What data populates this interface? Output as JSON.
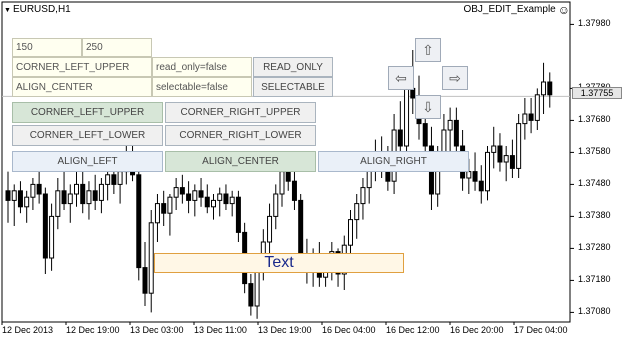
{
  "chart": {
    "symbol": "EURUSD,H1",
    "expert": "OBJ_EDIT_Example",
    "current_price": "1.37755",
    "price_labels": [
      "1.37980",
      "1.37780",
      "1.37680",
      "1.37580",
      "1.37480",
      "1.37380",
      "1.37280",
      "1.37180",
      "1.37080"
    ],
    "time_labels": [
      "12 Dec 2013",
      "12 Dec 19:00",
      "13 Dec 03:00",
      "13 Dec 11:00",
      "13 Dec 19:00",
      "16 Dec 04:00",
      "16 Dec 12:00",
      "16 Dec 20:00",
      "17 Dec 04:00"
    ],
    "colors": {
      "bull": "#ffffff",
      "bear": "#000000",
      "wick": "#000000",
      "grid": "#ffffff",
      "ask_line": "#c0c0c0"
    },
    "candles": [
      [
        1.3746,
        1.3752,
        1.3736,
        1.3743
      ],
      [
        1.3743,
        1.3748,
        1.3735,
        1.3746
      ],
      [
        1.3746,
        1.3749,
        1.3739,
        1.3741
      ],
      [
        1.3741,
        1.3746,
        1.3736,
        1.3744
      ],
      [
        1.3744,
        1.375,
        1.374,
        1.3748
      ],
      [
        1.3748,
        1.3752,
        1.3742,
        1.3745
      ],
      [
        1.3745,
        1.3747,
        1.372,
        1.3725
      ],
      [
        1.3725,
        1.3742,
        1.3721,
        1.3738
      ],
      [
        1.3738,
        1.375,
        1.3734,
        1.3746
      ],
      [
        1.3746,
        1.3752,
        1.374,
        1.3742
      ],
      [
        1.3742,
        1.3748,
        1.3736,
        1.3745
      ],
      [
        1.3745,
        1.3752,
        1.3741,
        1.3748
      ],
      [
        1.3748,
        1.3752,
        1.3739,
        1.3742
      ],
      [
        1.3742,
        1.3749,
        1.3737,
        1.3746
      ],
      [
        1.3746,
        1.3751,
        1.374,
        1.3743
      ],
      [
        1.3743,
        1.375,
        1.3739,
        1.3748
      ],
      [
        1.3748,
        1.3756,
        1.3743,
        1.3751
      ],
      [
        1.3751,
        1.3758,
        1.3745,
        1.3748
      ],
      [
        1.3748,
        1.3755,
        1.3742,
        1.3752
      ],
      [
        1.3752,
        1.376,
        1.3748,
        1.3755
      ],
      [
        1.3755,
        1.3761,
        1.3749,
        1.3751
      ],
      [
        1.3751,
        1.3754,
        1.3718,
        1.3722
      ],
      [
        1.3722,
        1.373,
        1.371,
        1.3714
      ],
      [
        1.3714,
        1.374,
        1.3708,
        1.3736
      ],
      [
        1.3736,
        1.3745,
        1.373,
        1.3742
      ],
      [
        1.3742,
        1.3746,
        1.3735,
        1.3739
      ],
      [
        1.3739,
        1.3745,
        1.3732,
        1.3744
      ],
      [
        1.3744,
        1.375,
        1.374,
        1.3747
      ],
      [
        1.3747,
        1.3751,
        1.3742,
        1.3745
      ],
      [
        1.3745,
        1.3749,
        1.3739,
        1.3743
      ],
      [
        1.3743,
        1.3748,
        1.3738,
        1.3746
      ],
      [
        1.3746,
        1.375,
        1.3741,
        1.3744
      ],
      [
        1.3744,
        1.3748,
        1.3739,
        1.3741
      ],
      [
        1.3741,
        1.3745,
        1.3737,
        1.3743
      ],
      [
        1.3743,
        1.3747,
        1.3738,
        1.3745
      ],
      [
        1.3745,
        1.3748,
        1.374,
        1.3742
      ],
      [
        1.3742,
        1.3746,
        1.3738,
        1.3744
      ],
      [
        1.3744,
        1.3746,
        1.373,
        1.3733
      ],
      [
        1.3733,
        1.3736,
        1.3714,
        1.3717
      ],
      [
        1.3717,
        1.372,
        1.3707,
        1.371
      ],
      [
        1.371,
        1.3726,
        1.3706,
        1.3724
      ],
      [
        1.3724,
        1.3734,
        1.3718,
        1.373
      ],
      [
        1.373,
        1.3742,
        1.3726,
        1.3738
      ],
      [
        1.3738,
        1.3748,
        1.3734,
        1.3745
      ],
      [
        1.3745,
        1.3755,
        1.3741,
        1.3752
      ],
      [
        1.3752,
        1.3758,
        1.3746,
        1.3749
      ],
      [
        1.3749,
        1.3754,
        1.374,
        1.3743
      ],
      [
        1.3743,
        1.3745,
        1.3722,
        1.3726
      ],
      [
        1.3726,
        1.3731,
        1.3717,
        1.3721
      ],
      [
        1.3721,
        1.3728,
        1.3716,
        1.3725
      ],
      [
        1.3725,
        1.373,
        1.3716,
        1.3719
      ],
      [
        1.3719,
        1.3726,
        1.3716,
        1.3723
      ],
      [
        1.3723,
        1.373,
        1.3718,
        1.3727
      ],
      [
        1.3727,
        1.3728,
        1.3716,
        1.372
      ],
      [
        1.372,
        1.3732,
        1.3715,
        1.3729
      ],
      [
        1.3729,
        1.374,
        1.3724,
        1.3737
      ],
      [
        1.3737,
        1.3745,
        1.3731,
        1.3742
      ],
      [
        1.3742,
        1.375,
        1.3737,
        1.3747
      ],
      [
        1.3747,
        1.3757,
        1.3742,
        1.3754
      ],
      [
        1.3754,
        1.3762,
        1.3749,
        1.3758
      ],
      [
        1.3758,
        1.3763,
        1.375,
        1.3753
      ],
      [
        1.3753,
        1.376,
        1.3746,
        1.3749
      ],
      [
        1.3749,
        1.377,
        1.3745,
        1.3765
      ],
      [
        1.3765,
        1.3774,
        1.3756,
        1.376
      ],
      [
        1.376,
        1.3782,
        1.3756,
        1.3778
      ],
      [
        1.3778,
        1.379,
        1.377,
        1.3775
      ],
      [
        1.3775,
        1.3782,
        1.3762,
        1.3767
      ],
      [
        1.3767,
        1.3772,
        1.3755,
        1.376
      ],
      [
        1.376,
        1.3766,
        1.374,
        1.3745
      ],
      [
        1.3745,
        1.376,
        1.3741,
        1.3757
      ],
      [
        1.3757,
        1.377,
        1.3752,
        1.3765
      ],
      [
        1.3765,
        1.3772,
        1.3758,
        1.3768
      ],
      [
        1.3768,
        1.3772,
        1.3755,
        1.376
      ],
      [
        1.376,
        1.3765,
        1.3746,
        1.375
      ],
      [
        1.375,
        1.3756,
        1.3745,
        1.3752
      ],
      [
        1.3752,
        1.3758,
        1.3746,
        1.3749
      ],
      [
        1.3749,
        1.3754,
        1.3742,
        1.3746
      ],
      [
        1.3746,
        1.376,
        1.3743,
        1.3758
      ],
      [
        1.3758,
        1.3766,
        1.3753,
        1.376
      ],
      [
        1.376,
        1.3764,
        1.3752,
        1.3755
      ],
      [
        1.3755,
        1.376,
        1.3749,
        1.3757
      ],
      [
        1.3757,
        1.3762,
        1.375,
        1.3753
      ],
      [
        1.3753,
        1.377,
        1.375,
        1.3767
      ],
      [
        1.3767,
        1.3775,
        1.3762,
        1.377
      ],
      [
        1.377,
        1.3775,
        1.3764,
        1.3768
      ],
      [
        1.3768,
        1.3778,
        1.3765,
        1.3776
      ],
      [
        1.3776,
        1.3786,
        1.377,
        1.378
      ],
      [
        1.378,
        1.3783,
        1.3772,
        1.3776
      ]
    ]
  },
  "controls": {
    "edit_150": "150",
    "edit_250": "250",
    "edit_corner_left_upper": "CORNER_LEFT_UPPER",
    "edit_read_only": "read_only=false",
    "btn_read_only": "READ_ONLY",
    "edit_align_center": "ALIGN_CENTER",
    "edit_selectable": "selectable=false",
    "btn_selectable": "SELECTABLE",
    "btn_corner_left_upper": "CORNER_LEFT_UPPER",
    "btn_corner_right_upper": "CORNER_RIGHT_UPPER",
    "btn_corner_left_lower": "CORNER_LEFT_LOWER",
    "btn_corner_right_lower": "CORNER_RIGHT_LOWER",
    "btn_align_left": "ALIGN_LEFT",
    "btn_align_center": "ALIGN_CENTER",
    "btn_align_right": "ALIGN_RIGHT",
    "text_edit": "Text",
    "arrow_up": "⇧",
    "arrow_down": "⇩",
    "arrow_left": "⇦",
    "arrow_right": "⇨"
  }
}
